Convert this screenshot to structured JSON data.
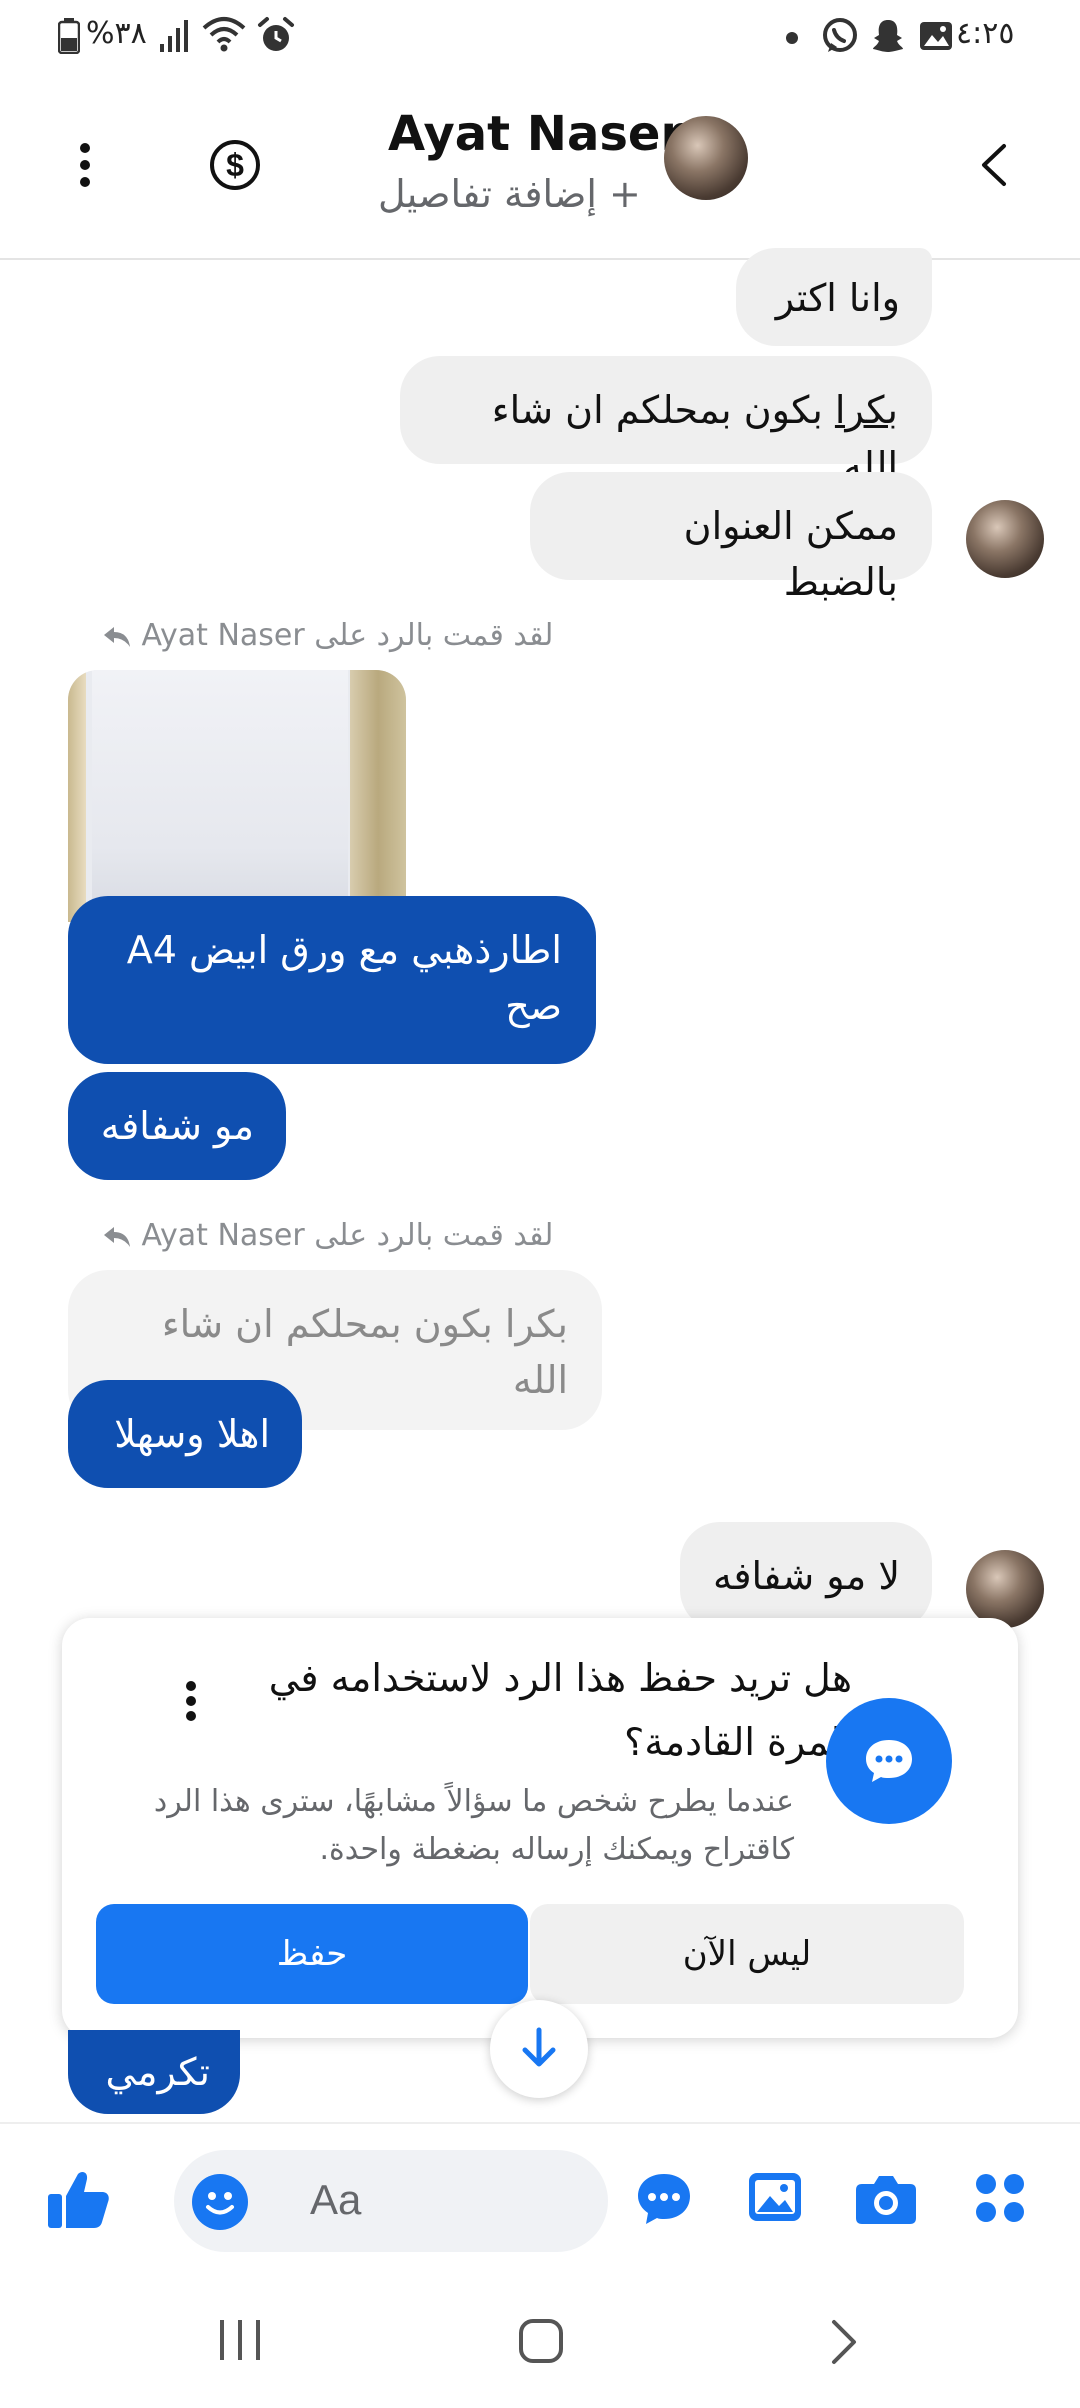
{
  "status": {
    "time": "٤:٢٥",
    "battery": "%٣٨"
  },
  "header": {
    "name": "Ayat Naser",
    "subtitle": "+ إضافة تفاصيل"
  },
  "messages": {
    "m1": "وانا اكتر",
    "m2_part1": "بكرا",
    "m2_part2": " بكون بمحلكم ان شاء الله",
    "m3": "ممكن العنوان بالضبط",
    "reply_label_1": "لقد قمت بالرد على Ayat Naser",
    "m4": "اطارذهبي  مع ورق ابيض A4 صح",
    "m5": "مو شفافه",
    "reply_label_2": "لقد قمت بالرد على Ayat Naser",
    "quoted": "بكرا بكون بمحلكم ان شاء الله",
    "m6": "اهلا وسهلا",
    "m7": "لا مو شفافه",
    "m8": "تكرمي"
  },
  "card": {
    "title": "هل تريد حفظ هذا الرد لاستخدامه في المرة القادمة؟",
    "body": "عندما يطرح شخص ما سؤالاً مشابهًا، سترى هذا الرد كاقتراح ويمكنك إرساله بضغطة واحدة.",
    "save": "حفظ",
    "later": "ليس الآن"
  },
  "composer": {
    "placeholder": "Aa"
  },
  "colors": {
    "messenger_blue": "#1877f2",
    "bubble_blue": "#0f4fb0",
    "grey_bubble": "#efefef"
  }
}
